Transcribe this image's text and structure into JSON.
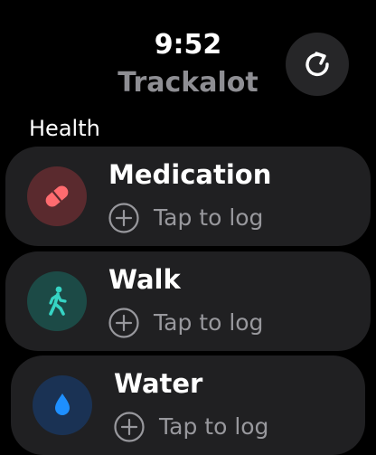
{
  "status": {
    "time": "9:52"
  },
  "app": {
    "title": "Trackalot",
    "refresh_icon": "refresh-icon"
  },
  "section": {
    "label": "Health"
  },
  "cards": [
    {
      "title": "Medication",
      "action": "Tap to log",
      "icon": "pill-icon",
      "icon_color": "#ff6b6f",
      "icon_bg": "#5a2a2e"
    },
    {
      "title": "Walk",
      "action": "Tap to log",
      "icon": "walking-figure-icon",
      "icon_color": "#36d4c4",
      "icon_bg": "#1c4a46"
    },
    {
      "title": "Water",
      "action": "Tap to log",
      "icon": "water-drop-icon",
      "icon_color": "#1e8fff",
      "icon_bg": "#1a3254"
    }
  ],
  "colors": {
    "background": "#000000",
    "card_background": "#202022",
    "secondary_text": "#8e8e93",
    "plus_icon": "#98989d"
  }
}
